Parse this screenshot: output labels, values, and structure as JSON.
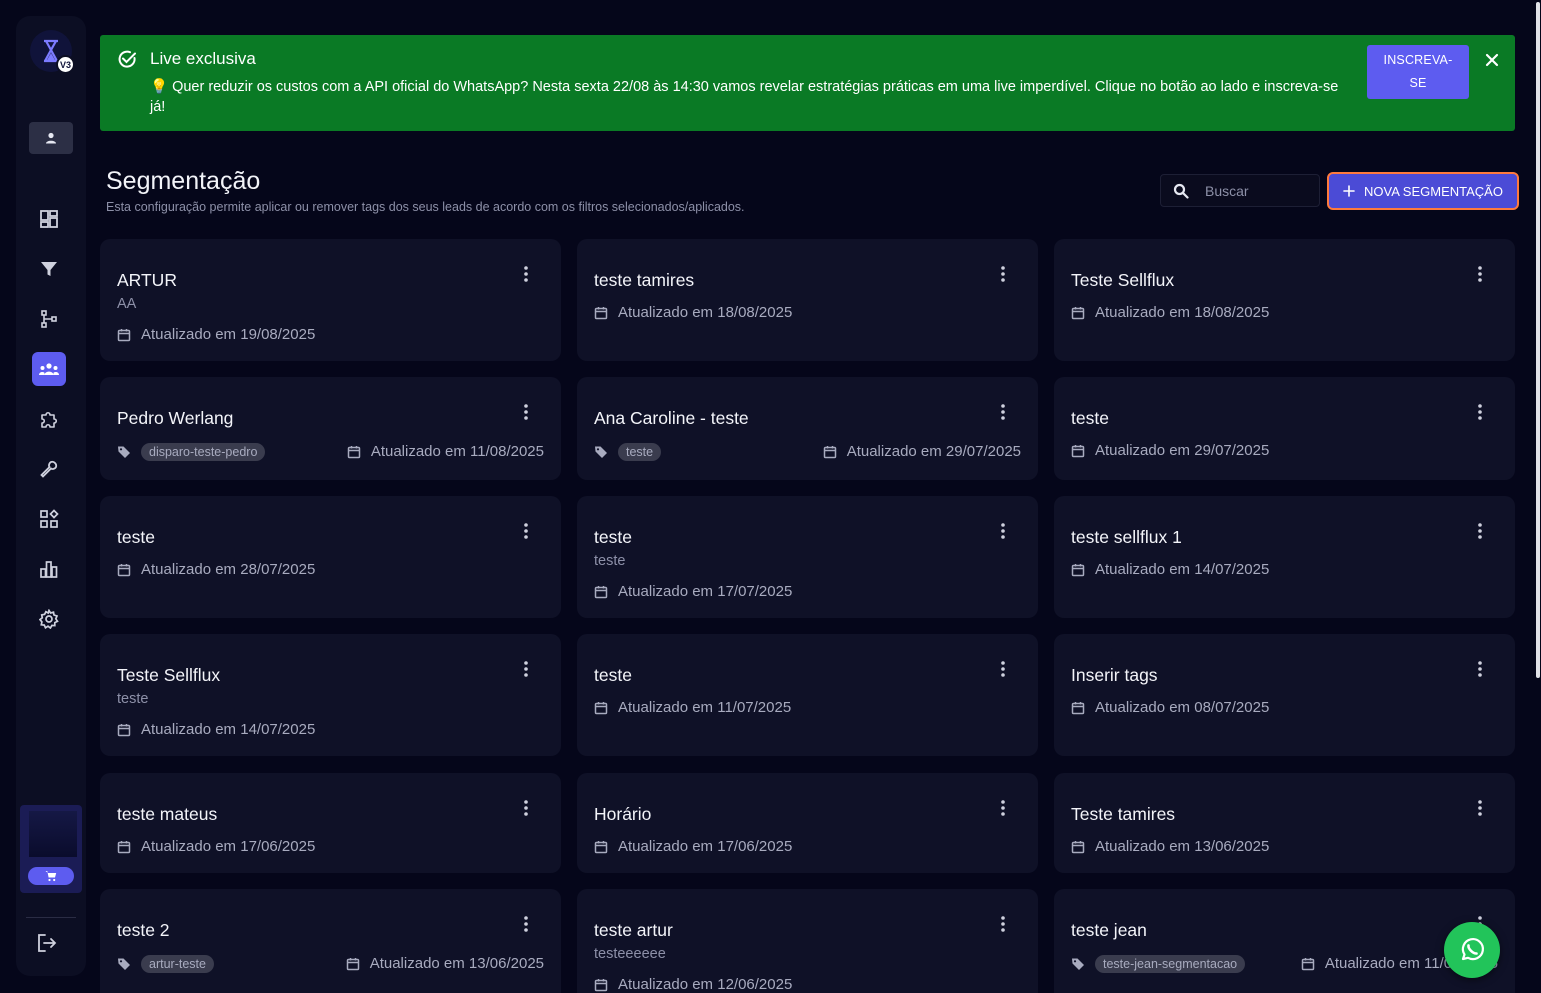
{
  "sidebar": {
    "logo_badge": "V3",
    "items": [
      {
        "name": "dashboard",
        "icon": "dashboard-icon",
        "active": false
      },
      {
        "name": "funnel",
        "icon": "funnel-icon",
        "active": false
      },
      {
        "name": "flows",
        "icon": "tree-icon",
        "active": false
      },
      {
        "name": "segmentation",
        "icon": "group-icon",
        "active": true
      },
      {
        "name": "integrations",
        "icon": "puzzle-icon",
        "active": false
      },
      {
        "name": "tools",
        "icon": "wrench-icon",
        "active": false
      },
      {
        "name": "apps",
        "icon": "apps-icon",
        "active": false
      },
      {
        "name": "reports",
        "icon": "bar-chart-icon",
        "active": false
      },
      {
        "name": "settings",
        "icon": "gear-icon",
        "active": false
      }
    ]
  },
  "banner": {
    "title": "Live exclusiva",
    "text": "💡 Quer reduzir os custos com a API oficial do WhatsApp? Nesta sexta 22/08 às 14:30 vamos revelar estratégias práticas em uma live imperdível. Clique no botão ao lado e inscreva-se já!",
    "button_line1": "INSCREVA-",
    "button_line2": "SE",
    "color": "#0a7a25"
  },
  "header": {
    "title": "Segmentação",
    "subtitle": "Esta configuração permite aplicar ou remover tags dos seus leads de acordo com os filtros selecionados/aplicados.",
    "search_placeholder": "Buscar",
    "new_button": "NOVA SEGMENTAÇÃO"
  },
  "cards": [
    {
      "name": "ARTUR",
      "desc": "AA",
      "tag": "",
      "date": "Atualizado em 19/08/2025"
    },
    {
      "name": "teste tamires",
      "desc": "",
      "tag": "",
      "date": "Atualizado em 18/08/2025"
    },
    {
      "name": "Teste Sellflux",
      "desc": "",
      "tag": "",
      "date": "Atualizado em 18/08/2025"
    },
    {
      "name": "Pedro Werlang",
      "desc": "",
      "tag": "disparo-teste-pedro",
      "date": "Atualizado em 11/08/2025"
    },
    {
      "name": "Ana Caroline - teste",
      "desc": "",
      "tag": "teste",
      "date": "Atualizado em 29/07/2025"
    },
    {
      "name": "teste",
      "desc": "",
      "tag": "",
      "date": "Atualizado em 29/07/2025"
    },
    {
      "name": "teste",
      "desc": "",
      "tag": "",
      "date": "Atualizado em 28/07/2025"
    },
    {
      "name": "teste",
      "desc": "teste",
      "tag": "",
      "date": "Atualizado em 17/07/2025"
    },
    {
      "name": "teste sellflux 1",
      "desc": "",
      "tag": "",
      "date": "Atualizado em 14/07/2025"
    },
    {
      "name": "Teste Sellflux",
      "desc": "teste",
      "tag": "",
      "date": "Atualizado em 14/07/2025"
    },
    {
      "name": "teste",
      "desc": "",
      "tag": "",
      "date": "Atualizado em 11/07/2025"
    },
    {
      "name": "Inserir tags",
      "desc": "",
      "tag": "",
      "date": "Atualizado em 08/07/2025"
    },
    {
      "name": "teste mateus",
      "desc": "",
      "tag": "",
      "date": "Atualizado em 17/06/2025"
    },
    {
      "name": "Horário",
      "desc": "",
      "tag": "",
      "date": "Atualizado em 17/06/2025"
    },
    {
      "name": "Teste tamires",
      "desc": "",
      "tag": "",
      "date": "Atualizado em 13/06/2025"
    },
    {
      "name": "teste 2",
      "desc": "",
      "tag": "artur-teste",
      "date": "Atualizado em 13/06/2025"
    },
    {
      "name": "teste artur",
      "desc": "testeeeeee",
      "tag": "",
      "date": "Atualizado em 12/06/2025"
    },
    {
      "name": "teste jean",
      "desc": "",
      "tag": "teste-jean-segmentacao",
      "date": "Atualizado em 11/06/2025"
    }
  ],
  "colors": {
    "accent": "#5d5cf0",
    "background": "#05061a",
    "card": "#0f1127",
    "whatsapp": "#22c45a"
  }
}
